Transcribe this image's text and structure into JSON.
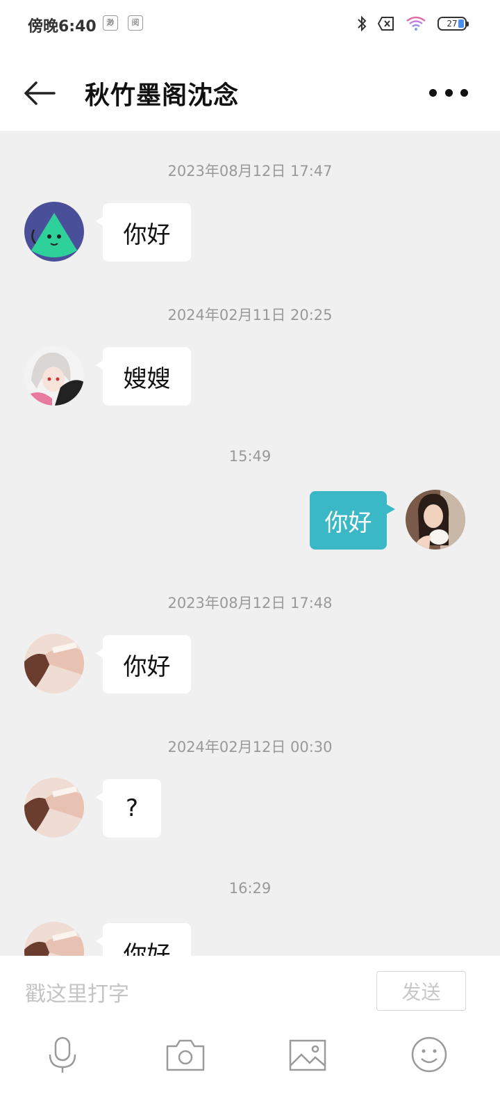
{
  "status_bar": {
    "time": "傍晚6:40",
    "app_icons": [
      "渺",
      "阅"
    ],
    "battery_level": "27",
    "icons": [
      "bluetooth-icon",
      "sim-error-icon",
      "wifi-icon",
      "battery-icon"
    ]
  },
  "header": {
    "title": "秋竹墨阁沈念",
    "back_icon": "arrow-left-icon",
    "more_icon": "more-horizontal-icon"
  },
  "messages": [
    {
      "timestamp": "2023年08月12日 17:47",
      "side": "left",
      "text": "你好",
      "avatar": "green-triangle-face"
    },
    {
      "timestamp": "2024年02月11日 20:25",
      "side": "left",
      "text": "嫂嫂",
      "avatar": "anime-girl"
    },
    {
      "timestamp": "15:49",
      "side": "right",
      "text": "你好",
      "avatar": "selfie-girl"
    },
    {
      "timestamp": "2023年08月12日 17:48",
      "side": "left",
      "text": "你好",
      "avatar": "portrait-photo"
    },
    {
      "timestamp": "2024年02月12日 00:30",
      "side": "left",
      "text": "?",
      "avatar": "portrait-photo"
    },
    {
      "timestamp": "16:29",
      "side": "left",
      "text": "你好",
      "avatar": "portrait-photo"
    }
  ],
  "input": {
    "placeholder": "戳这里打字",
    "value": "",
    "send_label": "发送"
  },
  "toolbar": {
    "icons": [
      "microphone-icon",
      "camera-icon",
      "image-icon",
      "emoji-icon"
    ]
  },
  "colors": {
    "chat_background": "#f0f0f0",
    "outgoing_bubble": "#3ab8c6",
    "incoming_bubble": "#ffffff",
    "timestamp_text": "#999999"
  }
}
